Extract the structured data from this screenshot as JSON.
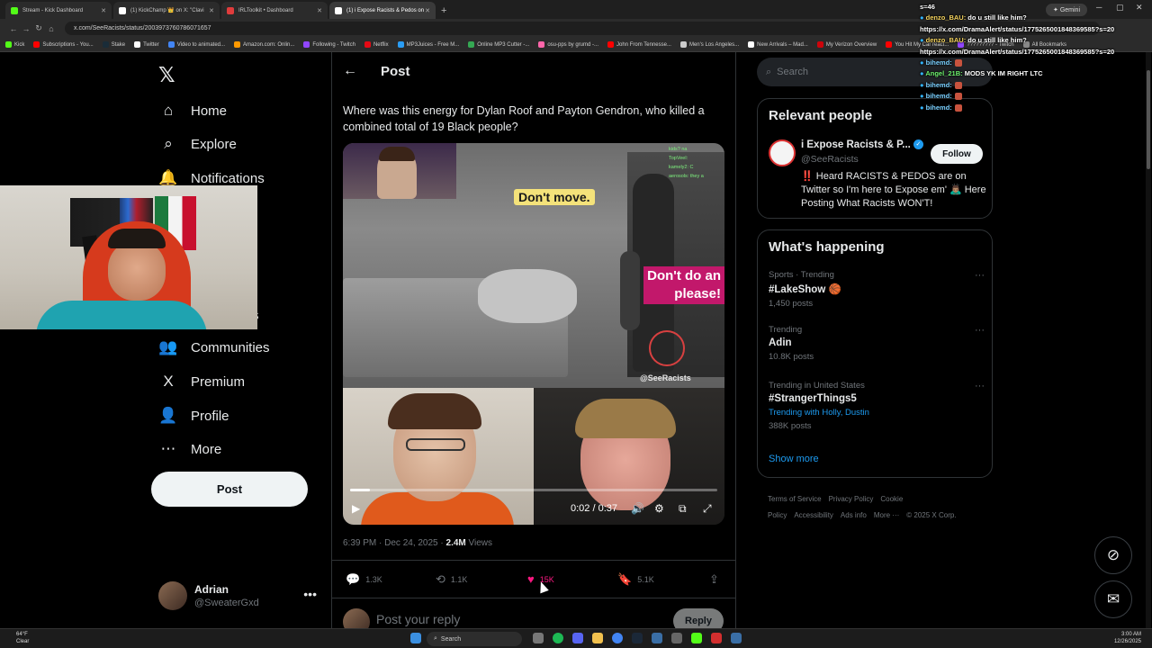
{
  "browser": {
    "tabs": [
      {
        "label": "Stream - Kick Dashboard",
        "color": "#53fc18"
      },
      {
        "label": "(1) KickChamp 👑 on X: \"Clavi",
        "color": "#ffffff"
      },
      {
        "label": "IRLToolkit • Dashboard",
        "color": "#e03c3c"
      },
      {
        "label": "(1) i Expose Racists & Pedos on",
        "color": "#ffffff"
      }
    ],
    "new_tab": "+",
    "gemini": "✦ Gemini",
    "url": "x.com/SeeRacists/status/2003973760786071657",
    "bookmarks": [
      {
        "label": "Kick",
        "color": "#53fc18"
      },
      {
        "label": "Subscriptions - You...",
        "color": "#ff0000"
      },
      {
        "label": "Stake",
        "color": "#1a2c38"
      },
      {
        "label": "Twitter",
        "color": "#ffffff"
      },
      {
        "label": "Video to animated...",
        "color": "#4285f4"
      },
      {
        "label": "Amazon.com: Onlin...",
        "color": "#ff9900"
      },
      {
        "label": "Following - Twitch",
        "color": "#9146ff"
      },
      {
        "label": "Netflix",
        "color": "#e50914"
      },
      {
        "label": "MP3Juices - Free M...",
        "color": "#2a9df4"
      },
      {
        "label": "Online MP3 Cutter -...",
        "color": "#35a853"
      },
      {
        "label": "osu-pps by grumd -...",
        "color": "#ff66aa"
      },
      {
        "label": "John From Tennesse...",
        "color": "#ff0000"
      },
      {
        "label": "Men's Los Angeles...",
        "color": "#cccccc"
      },
      {
        "label": "New Arrivals – Mad...",
        "color": "#ffffff"
      },
      {
        "label": "My Verizon Overview",
        "color": "#cd040b"
      },
      {
        "label": "You Hit My Car react...",
        "color": "#ff0000"
      },
      {
        "label": "????????? - Twitch",
        "color": "#9146ff"
      },
      {
        "label": "All Bookmarks",
        "color": "#888888"
      }
    ]
  },
  "nav": {
    "items": [
      {
        "label": "Home",
        "icon": "home-icon",
        "glyph": "⌂"
      },
      {
        "label": "Explore",
        "icon": "search-icon",
        "glyph": "⌕"
      },
      {
        "label": "Notifications",
        "icon": "bell-icon",
        "glyph": "🔔"
      },
      {
        "label": "Communities",
        "icon": "communities-icon",
        "glyph": "👥"
      },
      {
        "label": "Premium",
        "icon": "x-premium-icon",
        "glyph": "X"
      },
      {
        "label": "Profile",
        "icon": "profile-icon",
        "glyph": "👤"
      },
      {
        "label": "More",
        "icon": "more-circle-icon",
        "glyph": "⋯"
      }
    ],
    "partial_hidden_label": "s",
    "post_button": "Post",
    "account": {
      "name": "Adrian",
      "handle": "@SweaterGxd",
      "more": "•••"
    }
  },
  "post": {
    "header_title": "Post",
    "text": "Where was this energy for Dylan Roof and Payton Gendron, who killed a combined total of 19 Black people?",
    "video": {
      "caption_top": "Don't move.",
      "caption_side": "Don't do an\nplease!",
      "watermark": "@SeeRacists",
      "time": "0:02 / 0:37",
      "progress": 0.054,
      "mini_chat": [
        "kids? na",
        "TopVeel: ",
        "kamely2: C",
        "aerosols: they a"
      ]
    },
    "timestamp": "6:39 PM · Dec 24, 2025 · ",
    "views_count": "2.4M",
    "views_label": " Views",
    "actions": {
      "replies": "1.3K",
      "reposts": "1.1K",
      "likes": "15K",
      "bookmarks": "5.1K"
    },
    "reply_placeholder": "Post your reply",
    "reply_button": "Reply"
  },
  "sidebar": {
    "search_placeholder": "Search",
    "relevant_people": {
      "title": "Relevant people",
      "name": "i Expose Racists & P...",
      "handle": "@SeeRacists",
      "bio": "‼️ Heard RACISTS & PEDOS are on Twitter so I'm here to Expose em' 🙇🏽‍♂️ Here Posting What Racists WON'T!",
      "follow": "Follow"
    },
    "whats_happening": {
      "title": "What's happening",
      "trends": [
        {
          "category": "Sports · Trending",
          "name": "#LakeShow 🏀",
          "count": "1,450 posts",
          "with": ""
        },
        {
          "category": "Trending",
          "name": "Adin",
          "count": "10.8K posts",
          "with": ""
        },
        {
          "category": "Trending in United States",
          "name": "#StrangerThings5",
          "count": "388K posts",
          "with": "Holly, Dustin"
        }
      ],
      "trending_with_label": "Trending with ",
      "show_more": "Show more"
    },
    "footer": [
      "Terms of Service",
      "Privacy Policy",
      "Cookie Policy",
      "Accessibility",
      "Ads info",
      "More ···",
      "© 2025 X Corp."
    ]
  },
  "chat": [
    {
      "user": "",
      "text": "s=46"
    },
    {
      "user": "denzo_BAU:",
      "text": " do u still like him? https://x.com/DramaAlert/status/1775265001848369585?s=20"
    },
    {
      "user": "denzo_BAU:",
      "text": " do u still like him? https://x.com/DramaAlert/status/1775265001848369585?s=20"
    },
    {
      "user": "bihemd:",
      "text": ""
    },
    {
      "user": "Angel_21B:",
      "text": " MODS YK IM RIGHT LTC"
    },
    {
      "user": "bihemd:",
      "text": ""
    },
    {
      "user": "bihemd:",
      "text": ""
    },
    {
      "user": "bihemd:",
      "text": ""
    }
  ],
  "taskbar": {
    "weather_temp": "64°F",
    "weather_cond": "Clear",
    "search": "Search",
    "time": "3:00 AM",
    "date": "12/26/2025"
  }
}
